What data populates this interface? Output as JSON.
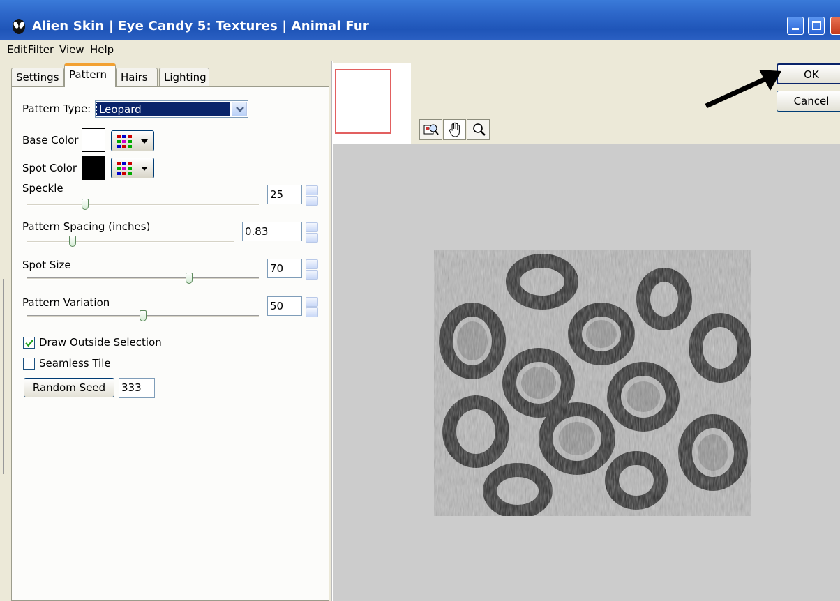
{
  "window": {
    "title": "Alien Skin | Eye Candy 5: Textures | Animal Fur"
  },
  "menu": [
    {
      "label": "Edit",
      "hotkey": "E",
      "rest": "dit"
    },
    {
      "label": "Filter",
      "hotkey": "F",
      "rest": "ilter"
    },
    {
      "label": "View",
      "hotkey": "V",
      "rest": "iew"
    },
    {
      "label": "Help",
      "hotkey": "H",
      "rest": "elp"
    }
  ],
  "tabs": [
    {
      "label": "Settings"
    },
    {
      "label": "Pattern",
      "active": true
    },
    {
      "label": "Hairs"
    },
    {
      "label": "Lighting"
    }
  ],
  "pattern": {
    "type_label": "Pattern Type:",
    "type_value": "Leopard",
    "base_color_label": "Base Color",
    "base_color": "#ffffff",
    "spot_color_label": "Spot Color",
    "spot_color": "#000000",
    "speckle": {
      "label": "Speckle",
      "value": "25",
      "level": 0.25
    },
    "spacing": {
      "label": "Pattern Spacing (inches)",
      "value": "0.83",
      "level": 0.22
    },
    "spot_size": {
      "label": "Spot Size",
      "value": "70",
      "level": 0.7
    },
    "variation": {
      "label": "Pattern Variation",
      "value": "50",
      "level": 0.5
    },
    "draw_outside": {
      "label": "Draw Outside Selection",
      "checked": true
    },
    "seamless": {
      "label": "Seamless Tile",
      "checked": false
    },
    "random_seed_label": "Random Seed",
    "random_seed_value": "333"
  },
  "buttons": {
    "ok": "OK",
    "cancel": "Cancel"
  },
  "tools": [
    "navigator-icon",
    "hand-icon",
    "zoom-icon"
  ]
}
